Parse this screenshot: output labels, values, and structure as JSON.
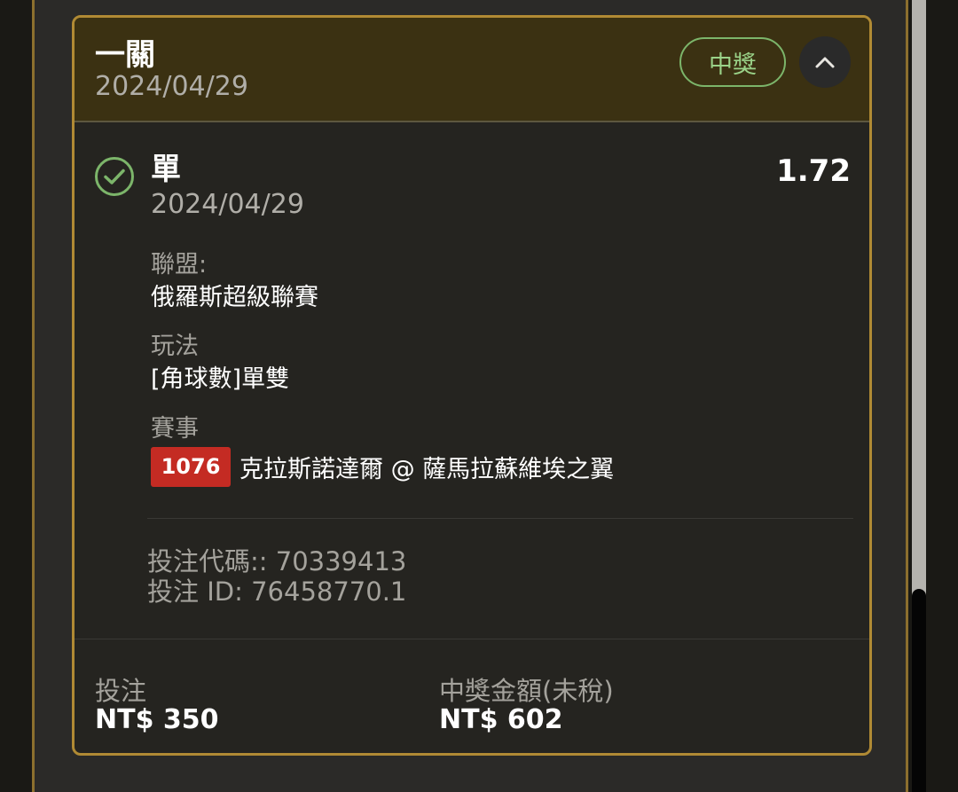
{
  "header": {
    "title": "一關",
    "date": "2024/04/29",
    "status": "中獎"
  },
  "bet": {
    "type": "單",
    "date": "2024/04/29",
    "odds": "1.72",
    "league_label": "聯盟:",
    "league_value": "俄羅斯超級聯賽",
    "play_label": "玩法",
    "play_value": "[角球數]單雙",
    "match_label": "賽事",
    "match_number": "1076",
    "match_name": "克拉斯諾達爾 @ 薩馬拉蘇維埃之翼",
    "code_line": "投注代碼:: 70339413",
    "id_line": "投注 ID: 76458770.1"
  },
  "footer": {
    "stake_label": "投注",
    "stake_value": "NT$ 350",
    "payout_label": "中獎金額(未稅)",
    "payout_value": "NT$ 602"
  },
  "colors": {
    "accent_gold": "#b08a34",
    "win_green": "#7cb56a",
    "badge_red": "#c42b23"
  },
  "icons": {
    "check": "check-circle-icon",
    "collapse": "chevron-up-icon"
  }
}
